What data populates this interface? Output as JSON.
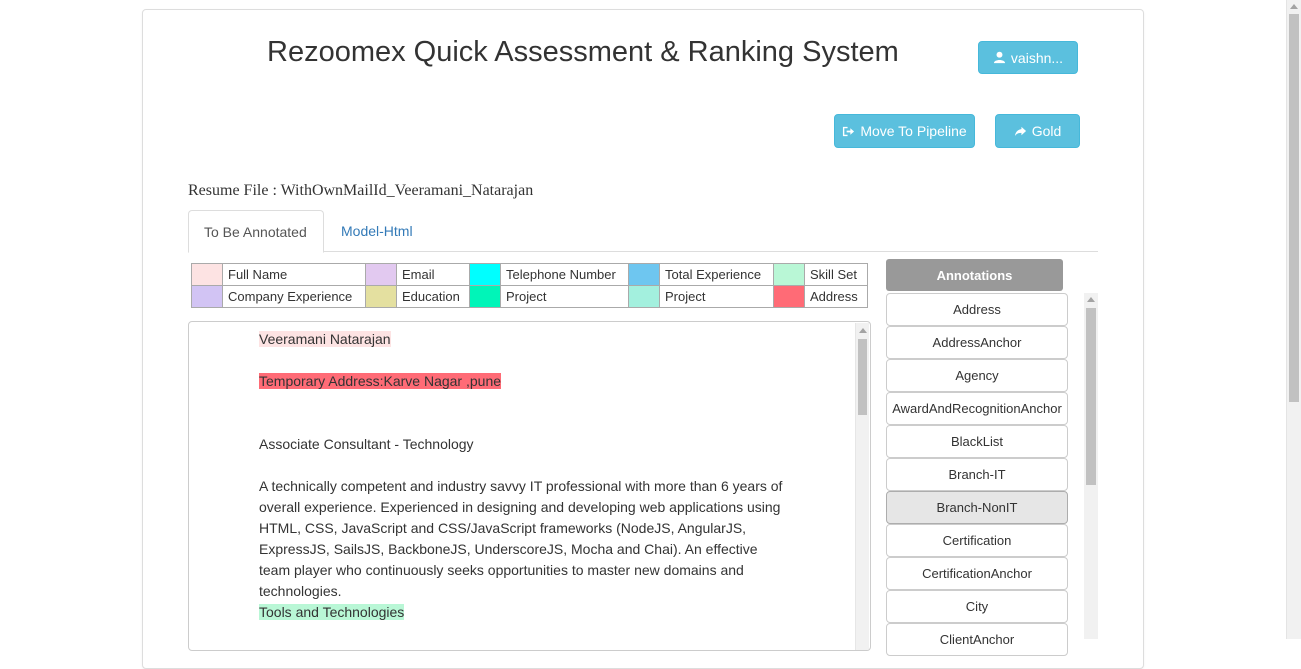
{
  "header": {
    "title": "Rezoomex Quick Assessment & Ranking System",
    "user_label": "vaishn..."
  },
  "actions": {
    "move_to_pipeline": "Move To Pipeline",
    "gold": "Gold"
  },
  "resume": {
    "label": "Resume File : ",
    "filename": "WithOwnMailId_Veeramani_Natarajan"
  },
  "tabs": [
    {
      "label": "To Be Annotated",
      "active": true
    },
    {
      "label": "Model-Html",
      "active": false
    }
  ],
  "legend": {
    "rows": [
      [
        {
          "label": "Full Name",
          "color": "#fde3e3"
        },
        {
          "label": "Email",
          "color": "#e2c9f0"
        },
        {
          "label": "Telephone Number",
          "color": "#00ffff"
        },
        {
          "label": "Total Experience",
          "color": "#6ec6f0"
        },
        {
          "label": "Skill Set",
          "color": "#b9f7d6"
        }
      ],
      [
        {
          "label": "Company Experience",
          "color": "#d2c4f4"
        },
        {
          "label": "Education",
          "color": "#e4e0a0"
        },
        {
          "label": "Project",
          "color": "#00f5b8"
        },
        {
          "label": "Project",
          "color": "#a3f0de"
        },
        {
          "label": "Address",
          "color": "#ff6b76"
        }
      ]
    ]
  },
  "document": {
    "name": "Veeramani Natarajan",
    "address": " Temporary Address:Karve Nagar ,pune",
    "role": "Associate Consultant - Technology",
    "summary": "A technically competent and industry savvy IT professional with more than 6 years of overall experience. Experienced in designing and developing web applications using HTML, CSS, JavaScript and CSS/JavaScript frameworks (NodeJS, AngularJS, ExpressJS, SailsJS, BackboneJS, UnderscoreJS, Mocha and Chai). An effective team player who continuously seeks opportunities to master new domains and technologies.",
    "tools_heading": "Tools and Technologies"
  },
  "annotations": {
    "header": "Annotations",
    "items": [
      "Address",
      "AddressAnchor",
      "Agency",
      "AwardAndRecognitionAnchor",
      "BlackList",
      "Branch-IT",
      "Branch-NonIT",
      "Certification",
      "CertificationAnchor",
      "City",
      "ClientAnchor"
    ],
    "selected": "Branch-NonIT"
  },
  "colors": {
    "button_info": "#5bc0de",
    "link": "#337ab7",
    "annotation_header": "#999999"
  }
}
